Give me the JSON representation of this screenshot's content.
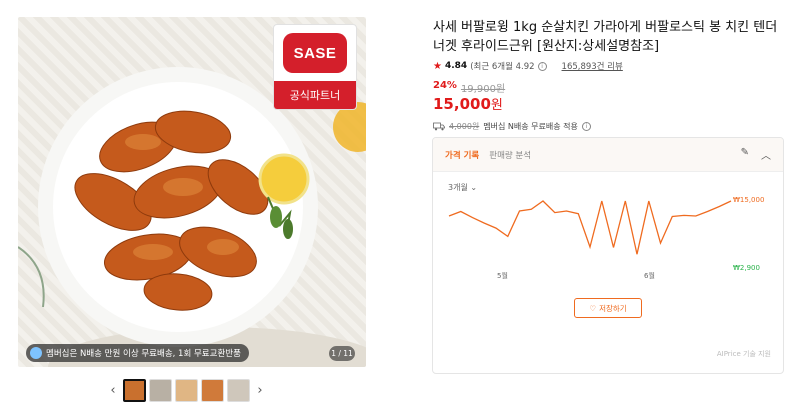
{
  "product": {
    "title": "사세 버팔로윙 1kg 순살치킨 가라아게 버팔로스틱 봉 치킨 텐더 너겟 후라이드근위 [원산지:상세설명참조]",
    "rating": "4.84",
    "rating_recent": "(최근 6개월 4.92",
    "review_count": "165,893건 리뷰",
    "discount": "24%",
    "original_price": "19,900원",
    "price": "15,000",
    "price_unit": "원",
    "shipping_old": "4,000원",
    "shipping_text": "멤버십 N배송 무료배송 적용"
  },
  "gallery": {
    "partner_logo": "SASE",
    "partner_label": "공식파트너",
    "promo": "멤버십은 N배송 만원 이상 무료배송, 1회 무료교환반품",
    "counter": "1 / 11",
    "prev": "‹",
    "next": "›",
    "thumb_colors": [
      "#c9702e",
      "#b8b0a4",
      "#e0b684",
      "#d07a3a",
      "#cfc7bb"
    ]
  },
  "price_card": {
    "tab_active": "가격 기록",
    "tab_other": "판매량 분석",
    "period": "3개월",
    "save_label": "저장하기",
    "powered": "AIPrice 기술 지원",
    "accent": "#ef6b20"
  },
  "chart_data": {
    "type": "line",
    "x_labels": [
      "5월",
      "6월"
    ],
    "max_label": "₩15,000",
    "min_label": "₩2,900",
    "values": [
      12300,
      13100,
      12000,
      11000,
      10100,
      8600,
      13200,
      13500,
      15000,
      12900,
      13200,
      12700,
      6700,
      15000,
      6600,
      15000,
      5400,
      15000,
      7400,
      12200,
      12400,
      12300,
      13100,
      14000,
      15000
    ],
    "ylim": [
      2900,
      15000
    ]
  }
}
